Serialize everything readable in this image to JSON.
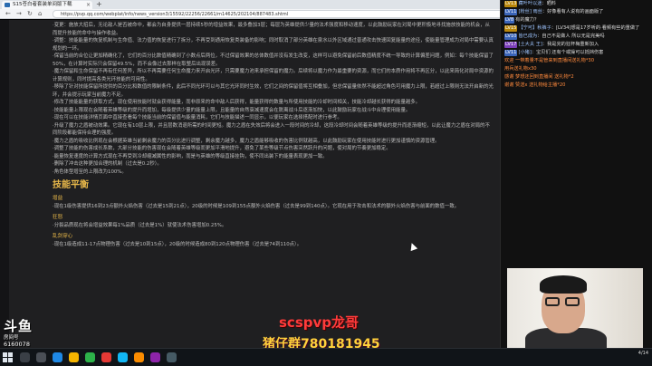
{
  "browser": {
    "tab_title": "S15苍白者套装单间版下载",
    "url": "https://pvp.qq.com/webplat/info/news_version3/15592/22256/22661/m14625/202104/887483.shtml"
  },
  "article": {
    "paragraphs": [
      "·变更：施放大招后，无论敌人是否被命中，都会为自身提供一层持续5秒的增益效果，最多叠加3层；每层为英雄提供少量的法术强度和移动速度，以此鼓励玩家在对局中更积极地寻找施放技能的机会，从而提升技能的命中与操作收益。",
      "·调整：技能能量的恢复机制与生命值、法力值的恢复进行了拆分，不再受到通用恢复类装备的影响；同时取消了部分英雄在泉水以外区域通过普通攻击快速回复能量的途径，使能量管理成为对局中需要认真规划的一环。",
      "·保留当前的合位让更加精确化了，它们的百分比数值精确到了小数点后两位，不过保留效果的总体数值并没有发生改变，这样可以避免保留前后数值精度不统一导致的计算偏差问题，例如：每个技能保留了50%，在计算时实际只会保留49.5%，而不会像过去那样在取整后出现误差。",
      "·魔力保留和生命保留不再有任何差异，所以不再需要任何生命魔力来开启光环，只需要魔力池来承担保留的魔力。后续将以魔力作为最重要的资源，而它们的本质作用将不再区分，以此来简化对局中资源的计算规则，同时提高各类光环技能的可用性。",
      "·移除了针对技能保留所提供的百分比和数值的限制条件，此后不同光环可以与其它光环同时生效，它们之间的保留值将互相叠加，但总保留量依然不能超过角色可用魔力上限，若超过上限则无法开启新的光环，并会提示玩家当前魔力不足。",
      "·修改了技能能量的获取方式，现在使用技能时就会获得能量，而非原来的命中敌人后获得，能量获得的数量与所使用技能的冷却时间相关，技能冷却越长获得的能量越多。",
      "·技能能量上限现在会随着英雄等级的提升而增加，每级提供少量的能量上限，且能量的自然衰减速度会在脱离战斗后逐渐加快，以此鼓励玩家在战斗中合理使用能量。",
      "·现在可以在技能详情页面中直接查看每个技能当前的保留值与能量消耗，它们与技能描述一同显示，以便玩家在选择搭配时进行参考。",
      "·升级了魔力之盾被动效果。它现在有10层上限，并且层数消退所需的时间更短。魔力之盾在失效后将会进入一段时间的冷却，这段冷却时间会随着英雄等级的提升而逐渐缩短，以此让魔力之盾在对局的不同阶段都能保持合理的强度。",
      "·魔力之盾的吸收比例现在会根据英雄当前剩余魔力的百分比进行调整，剩余魔力越多，魔力之盾能够吸收的伤害比例就越高，以此鼓励玩家在使用技能时进行更加谨慎的资源管理。",
      "·调整了技能的伤害成长系数，大部分技能的伤害现在会随着英雄等级而更加平滑地提升，避免了某些等级节点伤害突然跃升的问题，使对局的节奏更加稳定。",
      "·能量恢复速度的计算方式现在不再受到冷却缩减属性的影响，而是与英雄的等级直接挂钩，使不同出装下的能量表现更加一致。",
      "·删除了冲击这种更加合理的机制（过去是0.2秒）。",
      "·角色体型增至的上限改为100%。"
    ],
    "section_title": "技能平衡",
    "subsections": [
      {
        "heading": "增益",
        "items": [
          "·现在1级伤害提供16到23点额外火焰伤害（过去是15到21点），20级的时候是109到155点额外火焰伤害（过去是99到140点）。它现在用于攻击和法术的额外火焰伤害与前面的数值一致。"
        ]
      },
      {
        "heading": "狂怒",
        "items": [
          "·分裂品质现在将会增益效果每1%品质（过去是1%）就使法术伤害增加0.25%。"
        ]
      },
      {
        "heading": "乱剑穿心",
        "items": [
          "·现在1级造成11-17点物理伤害（过去是10到15点），20级的时候造成80到120点物理伤害（过去是74到110点）。"
        ]
      }
    ]
  },
  "chat": {
    "messages": [
      {
        "level": "LV13",
        "level_style": "gold",
        "user": "藏叶叶以迷",
        "text": "：晒料"
      },
      {
        "level": "LV11",
        "level_style": "blue",
        "user": "[粉丝] 雨丝",
        "text": "：好像看有人说有的画面版了"
      },
      {
        "level": "LV8",
        "level_style": "blue",
        "user": "",
        "text": "有的魔力？"
      },
      {
        "level": "LV15",
        "level_style": "gold",
        "user": "【宁可】秋裤子",
        "text": "：[LV34]想是17岁听的·看频有些的重做了"
      },
      {
        "level": "LV10",
        "level_style": "blue",
        "user": "皆已成为",
        "text": "：自己不是做人 所以无是完美吗"
      },
      {
        "level": "LV17",
        "level_style": "purple",
        "user": "[土大夫 王]",
        "text": "：我是完的狂杯梅重新加入"
      },
      {
        "level": "LV11",
        "level_style": "blue",
        "user": "[小猪]",
        "text": "：宝贝们 还有个或操可以抵挡伤害"
      }
    ],
    "gifts": [
      "欢迎 一带着量不是管来到直播间送礼物*30",
      "用兵送礼物x30",
      "感谢 梦想还回到直播间 送礼物*2",
      "谢谢 赞送x 送礼物给主播*20"
    ]
  },
  "overlay": {
    "logo_text": "斗鱼",
    "logo_subtitle": "房间号",
    "room_number": "6160078",
    "streamer_name": "scspvp龙哥",
    "fan_group": "猪仔群780181945"
  },
  "taskbar": {
    "time": "4/14",
    "date": "4/14"
  },
  "colors": {
    "page_bg": "#1f1f21",
    "body_text": "#bfbfbf",
    "accent": "#e8b84a",
    "watermark_red": "#ff3b3b",
    "watermark_yellow": "#ffd23c"
  }
}
